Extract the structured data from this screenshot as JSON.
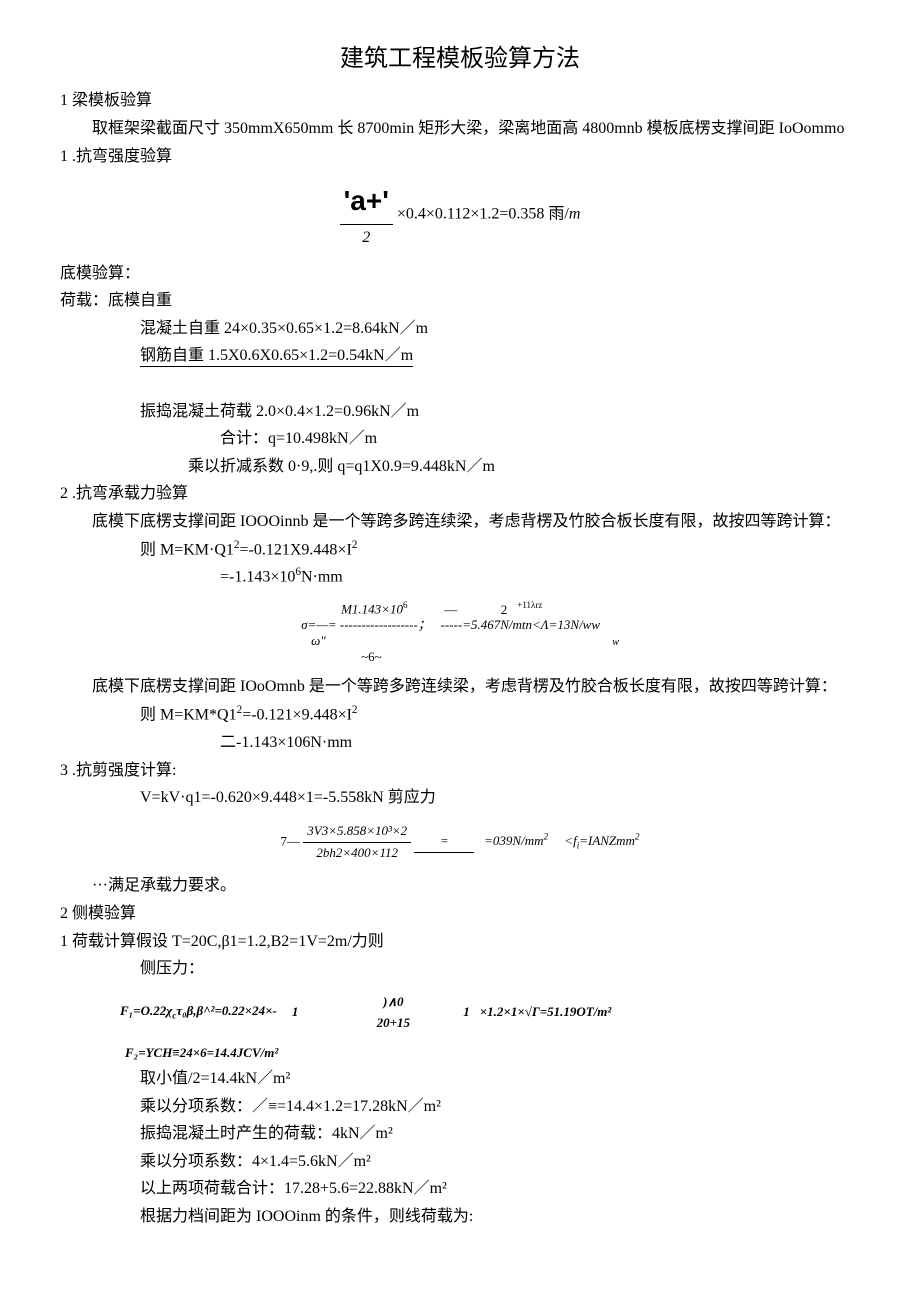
{
  "title": "建筑工程模板验算方法",
  "s1": {
    "heading": "1 梁模板验算",
    "p1": "取框架梁截面尺寸 350mmX650mm 长 8700min 矩形大梁，梁离地面高 4800mnb 模板底楞支撑间距 IoOommo",
    "h1_1": "1 .抗弯强度验算",
    "formula_a": "'a+'",
    "formula_a_tail": "×0.4×0.112×1.2=0.358 雨/",
    "formula_a_unit": "m",
    "formula_a_den": "2",
    "p2": "底模验算：",
    "p3": "荷载：底模自重",
    "p4": "混凝土自重 24×0.35×0.65×1.2=8.64kN／m",
    "p5": "钢筋自重 1.5X0.6X0.65×1.2=0.54kN／m",
    "p6": "振捣混凝土荷载 2.0×0.4×1.2=0.96kN／m",
    "p7": "合计：q=10.498kN／m",
    "p8": "乘以折减系数 0·9,.则 q=q1X0.9=9.448kN／m",
    "h1_2": "2 .抗弯承载力验算",
    "p9": "底模下底楞支撑间距 IOOOinnb 是一个等跨多跨连续梁，考虑背楞及竹胶合板长度有限，故按四等跨计算：",
    "p10_a": "则 M=KM·Q1",
    "p10_b": "=-0.121X9.448×I",
    "p11": "=-1.143×10",
    "p11_tail": "N·mm",
    "f1_line1": "M1.143×10",
    "f1_sigma": "σ=—= ------------------；",
    "f1_dash": "—",
    "f1_tail": "-----=5.467N/mtn<Λ=13N/ww",
    "f1_sup": "+11λrz",
    "f1_two": "2",
    "f1_omega": "ω\"",
    "f1_w": "w",
    "f1_six": "~6~",
    "p12": "底模下底楞支撑间距 IOoOmnb 是一个等跨多跨连续梁，考虑背楞及竹胶合板长度有限，故按四等跨计算：",
    "p13_a": "则 M=KM*Q1",
    "p13_b": "=-0.121×9.448×I",
    "p14": "二-1.143×106N·mm",
    "h1_3": "3 .抗剪强度计算:",
    "p15": "V=kV·q1=-0.620×9.448×1=-5.558kN 剪应力",
    "f2_pre": "7—",
    "f2_num": "3V3×5.858×10³×2",
    "f2_den": "2bh2×400×112",
    "f2_eq": "=039N/mm",
    "f2_lt": "<f",
    "f2_tail": "=IANZmm",
    "p16": "···满足承载力要求。"
  },
  "s2": {
    "heading": "2 侧模验算",
    "p1": "1 荷载计算假设 T=20C,β1=1.2,B2=1V=2m/力则",
    "p2": "侧压力：",
    "f3_a": "F₁=O.22χ",
    "f3_b": "τ₀β,β^²=0.22×24×-",
    "f3_one1": "1",
    "f3_mid": ")∧0",
    "f3_frac": "20+15",
    "f3_one2": "1",
    "f3_tail": "×1.2×1×√Γ=51.19OT/m²",
    "f4": "F₂=YCH≡24×6=14.4JCV/m²",
    "p3": "取小值/2=14.4kN／m²",
    "p4": "乘以分项系数：／≡=14.4×1.2=17.28kN／m²",
    "p5": "振捣混凝土时产生的荷载：4kN／m²",
    "p6": "乘以分项系数：4×1.4=5.6kN／m²",
    "p7": "以上两项荷载合计：17.28+5.6=22.88kN／m²",
    "p8": "根据力档间距为 IOOOinm 的条件，则线荷载为:"
  }
}
